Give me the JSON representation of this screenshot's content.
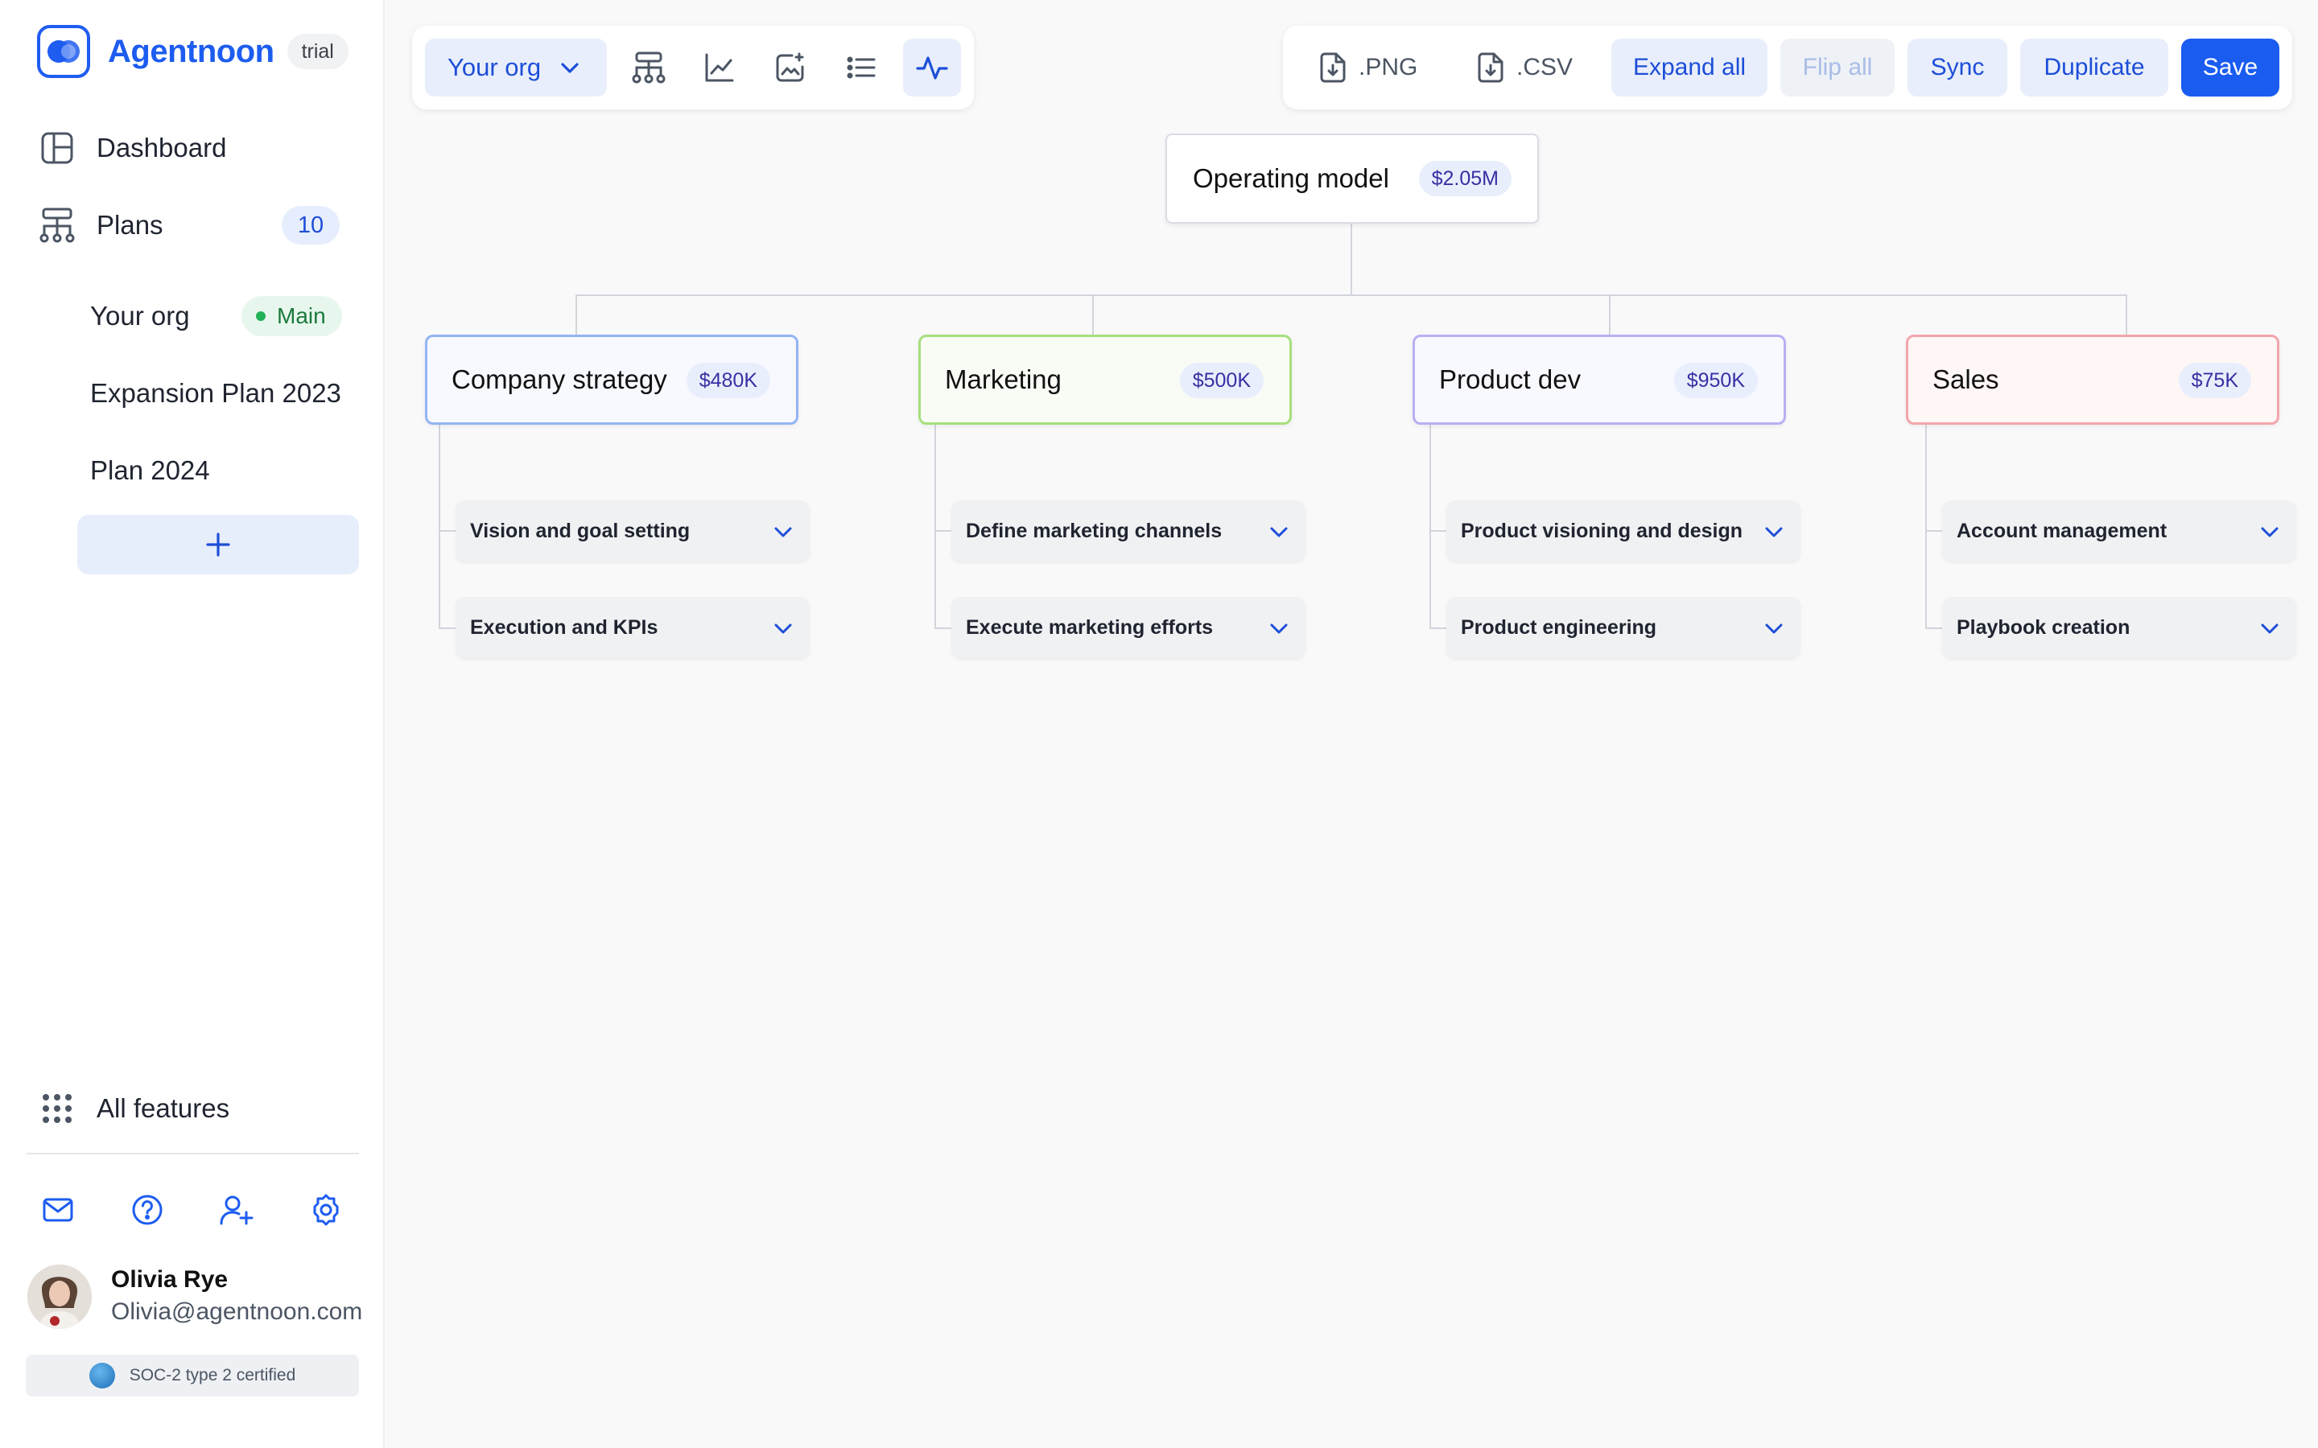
{
  "brand": {
    "name": "Agentnoon",
    "badge": "trial",
    "accent": "#1d5cf0"
  },
  "sidebar": {
    "nav": [
      {
        "label": "Dashboard",
        "icon": "layout-icon"
      },
      {
        "label": "Plans",
        "icon": "hierarchy-icon",
        "count": "10"
      }
    ],
    "plans": [
      {
        "label": "Your org",
        "badge": "Main"
      },
      {
        "label": "Expansion Plan 2023"
      },
      {
        "label": "Plan 2024"
      }
    ],
    "add_icon": "plus-icon",
    "all_features": "All features",
    "footer_icons": [
      "mail-icon",
      "help-icon",
      "add-user-icon",
      "settings-icon"
    ],
    "user": {
      "name": "Olivia Rye",
      "email": "Olivia@agentnoon.com"
    },
    "certification": "SOC-2 type 2 certified"
  },
  "toolbar": {
    "org_select": "Your org",
    "view_icons": [
      "org-chart-icon",
      "line-chart-icon",
      "image-chart-icon",
      "list-icon",
      "pulse-icon"
    ],
    "active_view": "pulse-icon",
    "export_png": ".PNG",
    "export_csv": ".CSV",
    "expand_all": "Expand all",
    "flip_all": "Flip all",
    "sync": "Sync",
    "duplicate": "Duplicate",
    "save": "Save"
  },
  "canvas": {
    "root": {
      "title": "Operating model",
      "amount": "$2.05M"
    },
    "departments": [
      {
        "title": "Company strategy",
        "amount": "$480K",
        "border": "#93b4f3",
        "bg": "#f7f9ff",
        "items": [
          "Vision and goal setting",
          "Execution and KPIs"
        ]
      },
      {
        "title": "Marketing",
        "amount": "$500K",
        "border": "#a7df7c",
        "bg": "#f8fcf5",
        "items": [
          "Define marketing channels",
          "Execute marketing efforts"
        ]
      },
      {
        "title": "Product dev",
        "amount": "$950K",
        "border": "#b7b0f2",
        "bg": "#f8f8ff",
        "items": [
          "Product visioning and design",
          "Product engineering"
        ]
      },
      {
        "title": "Sales",
        "amount": "$75K",
        "border": "#f3a6ab",
        "bg": "#fff6f6",
        "items": [
          "Account management",
          "Playbook creation"
        ]
      }
    ]
  }
}
